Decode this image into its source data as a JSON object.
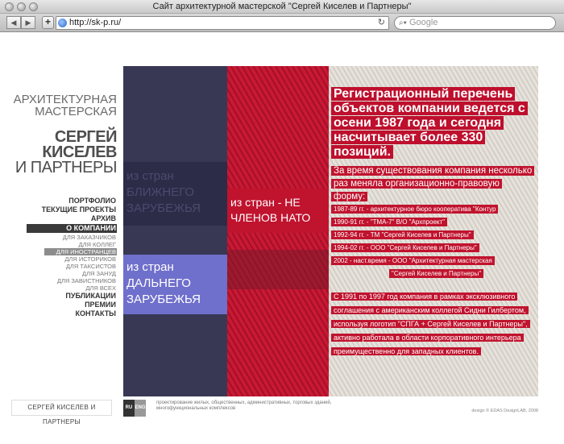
{
  "browser": {
    "title": "Сайт архитектурной мастерской \"Сергей Киселев и Партнеры\"",
    "url": "http://sk-p.ru/",
    "search_placeholder": "Google"
  },
  "brand": {
    "line1": "АРХИТЕКТУРНАЯ",
    "line2": "МАСТЕРСКАЯ",
    "name1": "СЕРГЕЙ",
    "name2": "КИСЕЛЕВ",
    "name3": "И ПАРТНЕРЫ"
  },
  "menu": {
    "items": [
      {
        "label": "ПОРТФОЛИО",
        "type": "main"
      },
      {
        "label": "ТЕКУЩИЕ ПРОЕКТЫ",
        "type": "main"
      },
      {
        "label": "АРХИВ",
        "type": "main"
      },
      {
        "label": "О КОМПАНИИ",
        "type": "active"
      },
      {
        "label": "ДЛЯ ЗАКАЗЧИКОВ",
        "type": "sub"
      },
      {
        "label": "ДЛЯ КОЛЛЕГ",
        "type": "sub"
      },
      {
        "label": "ДЛЯ ИНОСТРАНЦЕВ",
        "type": "subactive"
      },
      {
        "label": "ДЛЯ ИСТОРИКОВ",
        "type": "sub"
      },
      {
        "label": "ДЛЯ ТАКСИСТОВ",
        "type": "sub"
      },
      {
        "label": "ДЛЯ ЗАНУД",
        "type": "sub"
      },
      {
        "label": "ДЛЯ ЗАВИСТНИКОВ",
        "type": "sub"
      },
      {
        "label": "ДЛЯ ВСЕХ",
        "type": "sub"
      },
      {
        "label": "ПУБЛИКАЦИИ",
        "type": "main"
      },
      {
        "label": "ПРЕМИИ",
        "type": "main"
      },
      {
        "label": "КОНТАКТЫ",
        "type": "main"
      }
    ]
  },
  "blocks": {
    "near_abroad": "из стран БЛИЖНЕГО ЗАРУБЕЖЬЯ",
    "far_abroad": "из стран ДАЛЬНЕГО ЗАРУБЕЖЬЯ",
    "non_nato": "из стран - НЕ ЧЛЕНОВ НАТО"
  },
  "content": {
    "headline": "Регистрационный перечень объектов компании ведется с осени 1987 года и сегодня насчитывает более 330 позиций.",
    "para1": "За время существования компания несколько раз меняла организационно-правовую форму:",
    "history": [
      "1987-89 гг. - архитектурное бюро кооператива \"Контур",
      "1990-91 гг. - \"ТМА-7\" В/О \"Архпроект\"",
      "1992-94 гг. - ТМ \"Сергей Киселев и Партнеры\"",
      "1994-02 гг. - ООО \"Сергей Киселев и Партнеры\"",
      "2002 - наст.время - ООО \"Архитектурная мастерская",
      "\"Сергей Киселев и Партнеры\""
    ],
    "para3": "С 1991 по 1997 год компания в рамках эксклюзивного соглашения с американским коллегой Сидни Гилбертом, используя логотип \"СПГА + Сергей Киселев и Партнеры\", активно работала в области корпоративного интерьера преимущественно для западных клиентов."
  },
  "footer": {
    "logo_text": "СЕРГЕЙ КИСЕЛЕВ И ПАРТНЕРЫ",
    "lang_ru": "RU",
    "lang_en": "ENG",
    "description": "проектирование жилых, общественных, административных, торговых зданий, многофункциональных комплексов",
    "credit": "design © EDAS DesignLAB, 2008"
  }
}
